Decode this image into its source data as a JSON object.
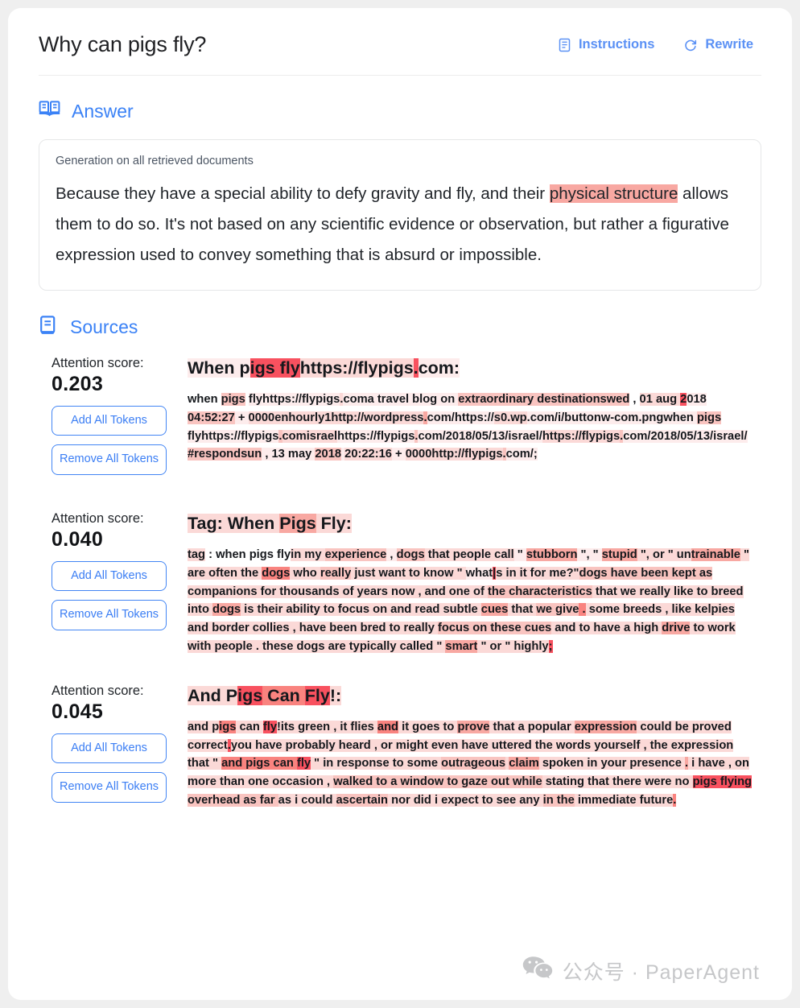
{
  "header": {
    "title": "Why can pigs fly?",
    "instructions_label": "Instructions",
    "rewrite_label": "Rewrite",
    "instructions_icon": "document-list-icon",
    "rewrite_icon": "refresh-icon",
    "accent_color": "#5b91f5"
  },
  "answer_section": {
    "heading": "Answer",
    "heading_icon": "open-book-icon",
    "caption": "Generation on all retrieved documents",
    "text_parts": [
      {
        "t": "Because they have a special ability to defy gravity and fly, and their ",
        "h": 0
      },
      {
        "t": "physical structure",
        "h": 4
      },
      {
        "t": " allows them to do so. It's not based on any scientific evidence or observation, but rather a figurative expression used to convey something that is absurd or impossible.",
        "h": 0
      }
    ],
    "full_text": "Because they have a special ability to defy gravity and fly, and their physical structure allows them to do so. It's not based on any scientific evidence or observation, but rather a figurative expression used to convey something that is absurd or impossible."
  },
  "sources_section": {
    "heading": "Sources",
    "heading_icon": "book-lines-icon",
    "attention_label": "Attention score:",
    "add_all_label": "Add All Tokens",
    "remove_all_label": "Remove All Tokens",
    "sources": [
      {
        "score": "0.203",
        "title_parts": [
          {
            "t": "When p",
            "h": 1
          },
          {
            "t": "igs fly",
            "h": 6
          },
          {
            "t": "https://flypigs",
            "h": 2
          },
          {
            "t": ".",
            "h": 6
          },
          {
            "t": "com:",
            "h": 1
          }
        ],
        "title_text": "When pigs flyhttps://flypigs.com:",
        "body_parts": [
          {
            "t": "when ",
            "h": 0
          },
          {
            "t": "pigs",
            "h": 3
          },
          {
            "t": " ",
            "h": 0
          },
          {
            "t": "flyhttps://flypigs",
            "h": 1
          },
          {
            "t": ".",
            "h": 2
          },
          {
            "t": "coma travel blog on ",
            "h": 1
          },
          {
            "t": "extraordinary destinationswed",
            "h": 3
          },
          {
            "t": " , ",
            "h": 0
          },
          {
            "t": "01 aug ",
            "h": 2
          },
          {
            "t": "2",
            "h": 6
          },
          {
            "t": "018 ",
            "h": 1
          },
          {
            "t": "04:52:27",
            "h": 3
          },
          {
            "t": " + ",
            "h": 1
          },
          {
            "t": "0000enhourly1http://wordpress",
            "h": 2
          },
          {
            "t": ".",
            "h": 4
          },
          {
            "t": "com/https://",
            "h": 1
          },
          {
            "t": "s0.wp",
            "h": 2
          },
          {
            "t": ".com/i/buttonw-com.pngwhen ",
            "h": 1
          },
          {
            "t": "pigs",
            "h": 3
          },
          {
            "t": " flyhttps://flypigs",
            "h": 1
          },
          {
            "t": ".",
            "h": 3
          },
          {
            "t": "comisrael",
            "h": 2
          },
          {
            "t": "https://flypigs",
            "h": 1
          },
          {
            "t": ".",
            "h": 3
          },
          {
            "t": "com/2018/05/13/israel/",
            "h": 1
          },
          {
            "t": "https://flypigs",
            "h": 2
          },
          {
            "t": ".",
            "h": 3
          },
          {
            "t": "com/2018/05/13/israel/",
            "h": 1
          },
          {
            "t": "#respondsun",
            "h": 3
          },
          {
            "t": " , 13 may ",
            "h": 1
          },
          {
            "t": "2018",
            "h": 3
          },
          {
            "t": " ",
            "h": 1
          },
          {
            "t": "20:22:16",
            "h": 2
          },
          {
            "t": " + ",
            "h": 1
          },
          {
            "t": "0000http://flypigs",
            "h": 2
          },
          {
            "t": ".",
            "h": 3
          },
          {
            "t": "com/;",
            "h": 1
          }
        ],
        "body_text": "when pigs flyhttps://flypigs.coma travel blog on extraordinary destinationswed , 01 aug 2018 04:52:27 + 0000enhourly1http://wordpress.com/https://s0.wp.com/i/buttonw-com.pngwhen pigs flyhttps://flypigs.comisraelhttps://flypigs.com/2018/05/13/israel/https://flypigs.com/2018/05/13/israel/#respondsun , 13 may 2018 20:22:16 + 0000http://flypigs.com/;"
      },
      {
        "score": "0.040",
        "title_parts": [
          {
            "t": "Tag: When ",
            "h": 2
          },
          {
            "t": "Pigs",
            "h": 4
          },
          {
            "t": " Fly:",
            "h": 2
          }
        ],
        "title_text": "Tag: When Pigs Fly:",
        "body_parts": [
          {
            "t": "tag",
            "h": 2
          },
          {
            "t": " : when pigs fly",
            "h": 0
          },
          {
            "t": "in my ",
            "h": 2
          },
          {
            "t": "experience",
            "h": 3
          },
          {
            "t": " , ",
            "h": 1
          },
          {
            "t": "dogs",
            "h": 3
          },
          {
            "t": " that people call",
            "h": 2
          },
          {
            "t": " \" ",
            "h": 1
          },
          {
            "t": "stubborn",
            "h": 4
          },
          {
            "t": " \", \" ",
            "h": 1
          },
          {
            "t": "stupid",
            "h": 4
          },
          {
            "t": " \", or \" ",
            "h": 2
          },
          {
            "t": "un",
            "h": 2
          },
          {
            "t": "trainable",
            "h": 4
          },
          {
            "t": " \" are often the ",
            "h": 2
          },
          {
            "t": "dogs",
            "h": 5
          },
          {
            "t": " who ",
            "h": 2
          },
          {
            "t": "really",
            "h": 3
          },
          {
            "t": " just want to know \" ",
            "h": 2
          },
          {
            "t": "what",
            "h": 1
          },
          {
            "t": "|",
            "h": 6
          },
          {
            "t": "s in it for me?\"",
            "h": 2
          },
          {
            "t": "dogs have been kept as ",
            "h": 3
          },
          {
            "t": "companions",
            "h": 2
          },
          {
            "t": " for thousands of years now , and one of ",
            "h": 2
          },
          {
            "t": "the characteristics",
            "h": 3
          },
          {
            "t": " that we really like to breed into ",
            "h": 2
          },
          {
            "t": "dogs",
            "h": 4
          },
          {
            "t": " is their ability to focus on and read subtle ",
            "h": 2
          },
          {
            "t": "cues",
            "h": 4
          },
          {
            "t": " that ",
            "h": 2
          },
          {
            "t": "we give",
            "h": 3
          },
          {
            "t": " .",
            "h": 5
          },
          {
            "t": " some breeds , like kelpies and border collies , have been bred to really ",
            "h": 2
          },
          {
            "t": "focus on these cues",
            "h": 3
          },
          {
            "t": " and to have a high ",
            "h": 2
          },
          {
            "t": "drive",
            "h": 4
          },
          {
            "t": " to work with people . these dogs are typically called \" ",
            "h": 2
          },
          {
            "t": "smart",
            "h": 4
          },
          {
            "t": " \" or \" highly",
            "h": 2
          },
          {
            "t": ";",
            "h": 6
          }
        ],
        "body_text": "tag : when pigs flyin my experience , dogs that people call \" stubborn \", \" stupid \", or \" untrainable \" are often the dogs who really just want to know \" what|s in it for me?\"dogs have been kept as companions for thousands of years now , and one of the characteristics that we really like to breed into dogs is their ability to focus on and read subtle cues that we give . some breeds , like kelpies and border collies , have been bred to really focus on these cues and to have a high drive to work with people . these dogs are typically called \" smart \" or \" highly;"
      },
      {
        "score": "0.045",
        "title_parts": [
          {
            "t": "And P",
            "h": 2
          },
          {
            "t": "igs",
            "h": 6
          },
          {
            "t": " Can ",
            "h": 5
          },
          {
            "t": "Fly",
            "h": 6
          },
          {
            "t": "!:",
            "h": 2
          }
        ],
        "title_text": "And Pigs Can Fly!:",
        "body_parts": [
          {
            "t": "and p",
            "h": 2
          },
          {
            "t": "igs",
            "h": 5
          },
          {
            "t": " can ",
            "h": 2
          },
          {
            "t": "fly",
            "h": 6
          },
          {
            "t": "!its green , it flies ",
            "h": 2
          },
          {
            "t": "and",
            "h": 5
          },
          {
            "t": " it goes to ",
            "h": 2
          },
          {
            "t": "prove",
            "h": 4
          },
          {
            "t": " that a popular ",
            "h": 2
          },
          {
            "t": "expression",
            "h": 4
          },
          {
            "t": " could be proved correct",
            "h": 2
          },
          {
            "t": ".",
            "h": 6
          },
          {
            "t": "you have probably heard , or might even have uttered the words yourself , the expression that \" ",
            "h": 2
          },
          {
            "t": "and pigs",
            "h": 5
          },
          {
            "t": " can ",
            "h": 5
          },
          {
            "t": "fly",
            "h": 6
          },
          {
            "t": " \" in response to some ",
            "h": 2
          },
          {
            "t": "outrageous",
            "h": 3
          },
          {
            "t": " ",
            "h": 2
          },
          {
            "t": "claim",
            "h": 4
          },
          {
            "t": " spoken in your presence ",
            "h": 2
          },
          {
            "t": ".",
            "h": 4
          },
          {
            "t": " i have , on more than one occasion , ",
            "h": 2
          },
          {
            "t": "walked to a window to gaze out while",
            "h": 3
          },
          {
            "t": " stating that there were no ",
            "h": 2
          },
          {
            "t": "pigs flying",
            "h": 6
          },
          {
            "t": " overhead as far ",
            "h": 3
          },
          {
            "t": "as i could ",
            "h": 2
          },
          {
            "t": "ascertain",
            "h": 3
          },
          {
            "t": " nor did i expect to see any ",
            "h": 2
          },
          {
            "t": "in the",
            "h": 3
          },
          {
            "t": " immediate future",
            "h": 2
          },
          {
            "t": ".",
            "h": 5
          }
        ],
        "body_text": "and pigs can fly!its green , it flies and it goes to prove that a popular expression could be proved correct.you have probably heard , or might even have uttered the words yourself , the expression that \" and pigs can fly \" in response to some outrageous claim spoken in your presence . i have , on more than one occasion , walked to a window to gaze out while stating that there were no pigs flying overhead as far as i could ascertain nor did i expect to see any in the immediate future ."
      }
    ]
  },
  "watermark": {
    "icon": "wechat-icon",
    "text": "公众号 · PaperAgent"
  }
}
